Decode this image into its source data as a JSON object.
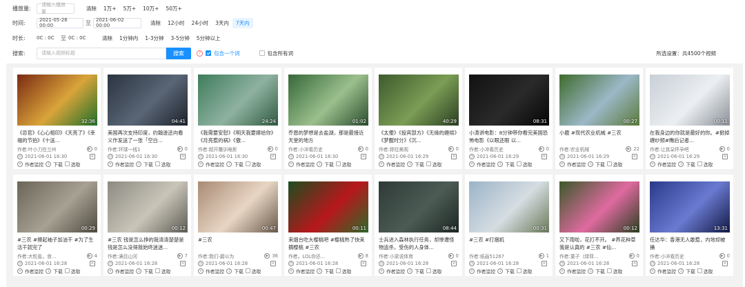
{
  "filters": {
    "plays": {
      "label": "播放量:",
      "placeholder": "请输入播放量",
      "options": [
        "清除",
        "1万+",
        "5万+",
        "10万+",
        "50万+"
      ]
    },
    "time": {
      "label": "时间:",
      "start": "2021-05-26 00:00",
      "to": "至",
      "end": "2021-06-02 00:00",
      "options": [
        "清除",
        "12小时",
        "24小时",
        "3天内",
        "7天内"
      ],
      "active": "7天内"
    },
    "duration": {
      "label": "时长:",
      "from": "0C : 0C",
      "to": "至",
      "end": "0C : 0C",
      "options": [
        "清除",
        "1分钟内",
        "1-3分钟",
        "3-5分钟",
        "5分钟以上"
      ]
    },
    "search": {
      "label": "搜索:",
      "placeholder": "请输入视频标题",
      "button": "搜索",
      "help": "?",
      "include_one": "包含一个词",
      "include_all": "包含所有词"
    },
    "selected_info": "所选设置：共4500个视频"
  },
  "card_actions": {
    "monitor": "作者监控",
    "download": "下载",
    "select": "选取"
  },
  "icons": {
    "plays": "play-icon",
    "time": "clock-icon",
    "doc": "doc-icon",
    "user": "user-icon"
  },
  "videos": [
    {
      "duration": "32:36",
      "title": "《忌官》《心心相印》《天亮了》《幸福的节拍》《十送...",
      "author": "作者:叶小刀在兰州",
      "plays": "0",
      "date": "2021-06-01 16:30",
      "thumb": [
        "#7a2a12",
        "#d9a43a",
        "#1f6f2a"
      ]
    },
    {
      "duration": "04:41",
      "title": "美国再次支持印度，约翰逊还向看义作发送了一张「空白...",
      "author": "作者:环球一线1",
      "plays": "0",
      "date": "2021-06-01 16:30",
      "thumb": [
        "#2b3440",
        "#5a6676",
        "#1c222b"
      ]
    },
    {
      "duration": "24:24",
      "title": "《我需要安慰》《明天我要嫁给你》《月亮惹的祸》《傲...",
      "author": "作者:超开雕训电影",
      "plays": "0",
      "date": "2021-06-01 16:30",
      "thumb": [
        "#3e7c5c",
        "#8fb2a0",
        "#2f5a3f"
      ]
    },
    {
      "duration": "01:02",
      "title": "乔恩的梦想是去盐湖，那是最接近天堂的地方",
      "author": "作者:小冲看历史",
      "plays": "0",
      "date": "2021-06-01 16:30",
      "thumb": [
        "#36683a",
        "#9bbf8c",
        "#2a4d2e"
      ]
    },
    {
      "duration": "40:29",
      "title": "《太傻》《投宾部方》《无缘的缠绵》《梦醒时分》《沉...",
      "author": "作者:妳拉美观",
      "plays": "0",
      "date": "2021-06-01 16:29",
      "thumb": [
        "#3d5a2d",
        "#7a9d55",
        "#2b3e21"
      ]
    },
    {
      "duration": "08:31",
      "title": "小涛讲电影：8分钟带你看完美国恐怖电影《以眼还眼 以...",
      "author": "作者:小冲看历史",
      "plays": "0",
      "date": "2021-06-01 16:29",
      "thumb": [
        "#111111",
        "#2a2a2a",
        "#050505"
      ]
    },
    {
      "duration": "00:27",
      "title": "小鹿 #现代农业机械 #三农",
      "author": "作者:农业机械",
      "plays": "22",
      "date": "2021-06-01 16:29",
      "thumb": [
        "#3f6b2c",
        "#9cb8c8",
        "#5a7a3a"
      ]
    },
    {
      "duration": "00:11",
      "title": "在我身边的你就是最好的你。#掀掉缠纱频#瞧后记者...",
      "author": "作者:让其朵怀孕吧",
      "plays": "0",
      "date": "2021-06-01 16:29",
      "thumb": [
        "#c8cfd6",
        "#eceff2",
        "#8a9097"
      ]
    },
    {
      "duration": "00:29",
      "title": "#三农 #擦起袖子加油干 #为了生活干就完了",
      "author": "作者:大粒盐，食...",
      "plays": "4",
      "date": "2021-06-01 16:28",
      "thumb": [
        "#6b6558",
        "#a7a193",
        "#4e4a40"
      ]
    },
    {
      "duration": "00:12",
      "title": "#三农 钱是怎么挣的我清清楚楚是 钱是怎么没得我始终迷迷...",
      "author": "作者:满目山河",
      "plays": "7",
      "date": "2021-06-01 16:28",
      "thumb": [
        "#8c8a82",
        "#c9c5b8",
        "#5e5c55"
      ]
    },
    {
      "duration": "00:47",
      "title": "#三农",
      "author": "作者:我们-磨以为",
      "plays": "36",
      "date": "2021-06-01 16:28",
      "thumb": [
        "#a88a74",
        "#e8d6c4",
        "#6a5a4b"
      ]
    },
    {
      "duration": "00:11",
      "title": "来烟台吃大樱桃吧 #樱桃熟了快来摘樱桃 #三农",
      "author": "作者。LOL你还...",
      "plays": "8",
      "date": "2021-06-01 16:28",
      "thumb": [
        "#1d4d1f",
        "#b8171c",
        "#2e6a2a"
      ]
    },
    {
      "duration": "08:44",
      "title": "士兵进入森林执行任务，却惨遭怪物追杀，受伤的人身体...",
      "author": "作者:小梁说体育",
      "plays": "0",
      "date": "2021-06-01 16:28",
      "thumb": [
        "#2e3a36",
        "#4c5c55",
        "#1c2622"
      ]
    },
    {
      "duration": "00:31",
      "title": "#三农 #打捆机",
      "author": "作者:纸画51267",
      "plays": "1",
      "date": "2021-06-01 16:28",
      "thumb": [
        "#9bb4c8",
        "#d6dde2",
        "#6b7a5a"
      ]
    },
    {
      "duration": "00:12",
      "title": "又下雨啦，花打不开。 #养花种草我是认真的 #三农 #仙...",
      "author": "作者:童子（绿菲...",
      "plays": "0",
      "date": "2021-06-01 16:28",
      "thumb": [
        "#3a5a2a",
        "#e06aa0",
        "#2b4020"
      ]
    },
    {
      "duration": "13:31",
      "title": "任达华：香港无人敢惹，内地却被捅",
      "author": "作者:小冲看历史",
      "plays": "0",
      "date": "2021-06-01 16:28",
      "thumb": [
        "#2a3a8a",
        "#6a7ad0",
        "#121a44"
      ]
    }
  ]
}
